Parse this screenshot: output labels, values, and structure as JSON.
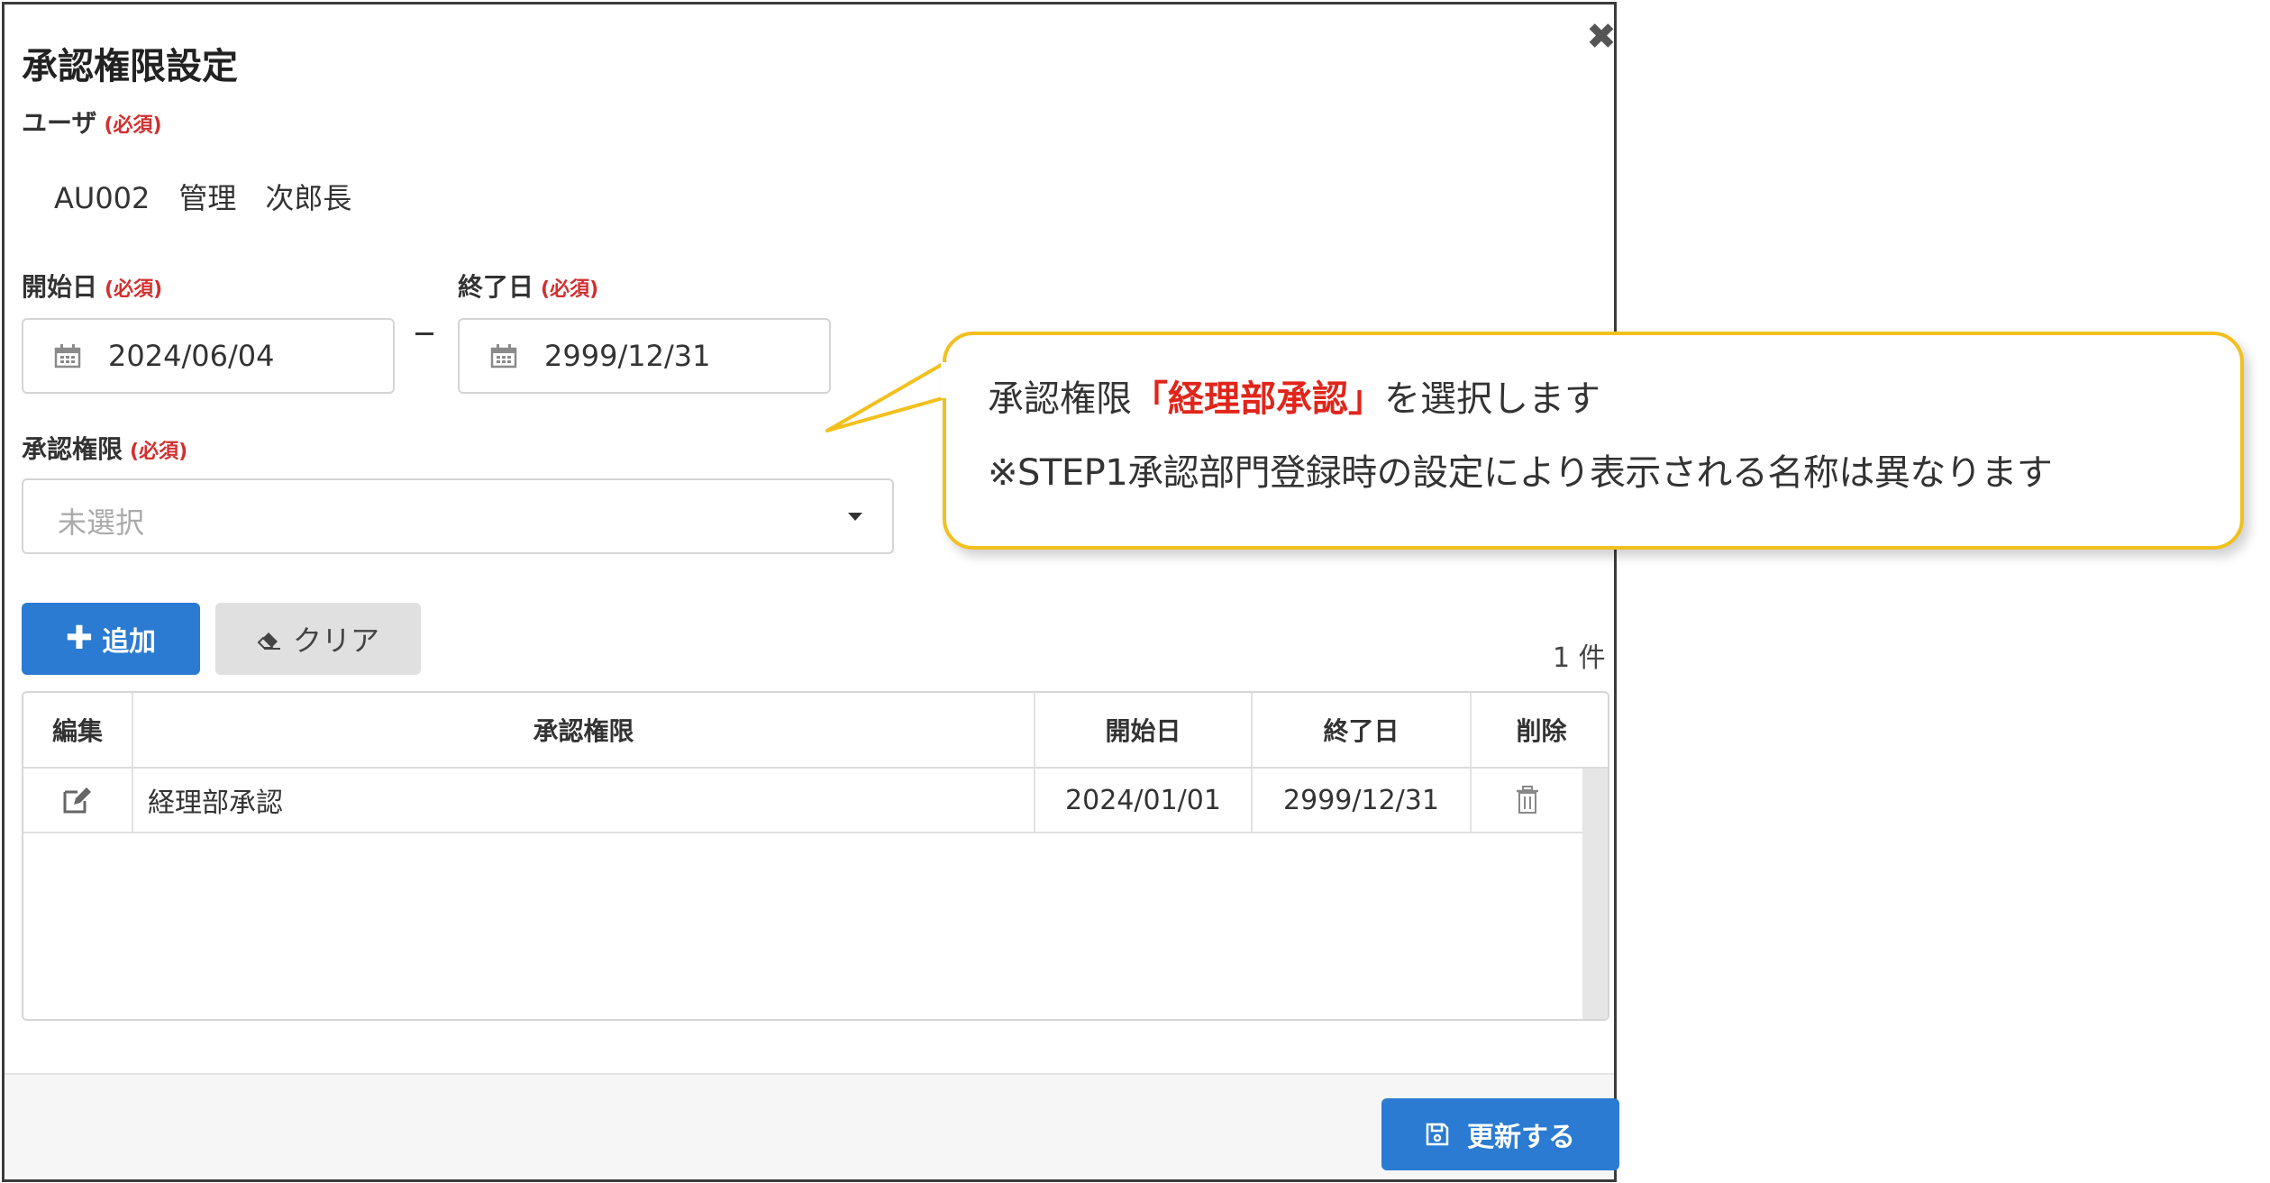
{
  "dialog": {
    "title": "承認権限設定",
    "close_label": "✖",
    "required_label": "(必須)",
    "user": {
      "label": "ユーザ",
      "value": "AU002　管理　次郎長"
    },
    "start_date": {
      "label": "開始日",
      "value": "2024/06/04"
    },
    "end_date": {
      "label": "終了日",
      "value": "2999/12/31"
    },
    "authority": {
      "label": "承認権限",
      "placeholder": "未選択"
    },
    "buttons": {
      "add": "追加",
      "clear": "クリア",
      "update": "更新する"
    },
    "count_text": "1 件",
    "table": {
      "headers": [
        "編集",
        "承認権限",
        "開始日",
        "終了日",
        "削除"
      ],
      "rows": [
        {
          "authority": "経理部承認",
          "start": "2024/01/01",
          "end": "2999/12/31"
        }
      ]
    }
  },
  "callout": {
    "line1_before": "承認権限",
    "line1_highlight": "「経理部承認」",
    "line1_after": "を選択します",
    "line2": "※STEP1承認部門登録時の設定により表示される名称は異なります"
  },
  "colors": {
    "primary_button": "#2a7bd1",
    "required": "#d32f2f",
    "callout_border": "#f2c01e",
    "callout_highlight": "#e1251b"
  },
  "icons": [
    "close-icon",
    "calendar-icon",
    "plus-icon",
    "eraser-icon",
    "edit-icon",
    "trash-icon",
    "save-icon"
  ]
}
